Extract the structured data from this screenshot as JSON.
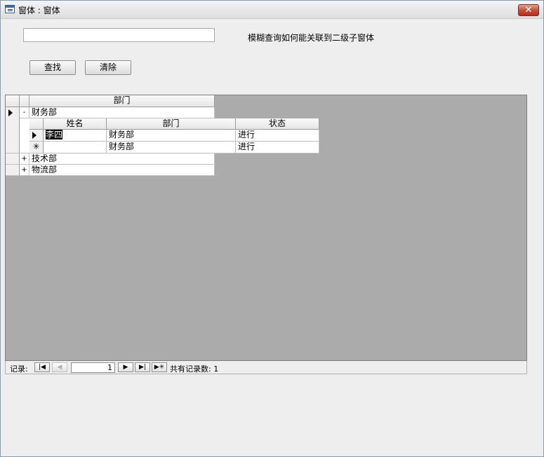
{
  "window": {
    "title": "窗体 : 窗体",
    "close_label": "✕"
  },
  "search": {
    "value": "",
    "placeholder": ""
  },
  "hint_label": "模糊查询如何能关联到二级子窗体",
  "buttons": {
    "find_label": "查找",
    "clear_label": "清除"
  },
  "datasheet": {
    "header": "部门",
    "rows": [
      {
        "expander": "-",
        "value": "财务部",
        "current": true
      },
      {
        "expander": "+",
        "value": "技术部"
      },
      {
        "expander": "+",
        "value": "物流部"
      }
    ],
    "subform": {
      "columns": [
        "姓名",
        "部门",
        "状态"
      ],
      "rows": [
        {
          "indicator": "current",
          "cells": [
            "李四",
            "财务部",
            "进行"
          ]
        },
        {
          "indicator": "new",
          "indicator_symbol": "✳",
          "cells": [
            "",
            "财务部",
            "进行"
          ]
        }
      ]
    }
  },
  "navigation": {
    "label": "记录:",
    "first": "|◀",
    "prev": "◀",
    "record_value": "1",
    "next": "▶",
    "last": "▶|",
    "new": "▶✳",
    "count_label": "共有记录数: 1"
  }
}
